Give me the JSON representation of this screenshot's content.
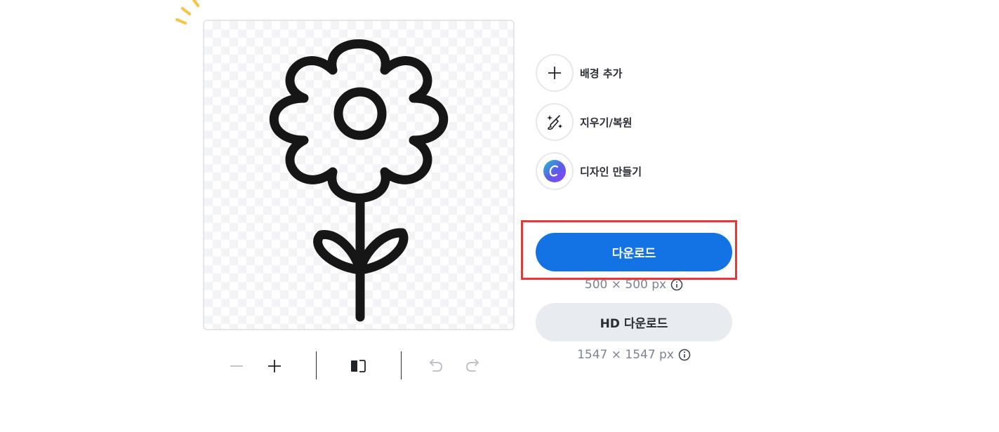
{
  "actions": [
    {
      "label": "배경 추가",
      "icon": "plus-icon"
    },
    {
      "label": "지우기/복원",
      "icon": "magic-brush-icon"
    },
    {
      "label": "디자인 만들기",
      "icon": "canva-logo-icon"
    }
  ],
  "download": {
    "button_label": "다운로드",
    "size_label": "500 × 500 px"
  },
  "hd_download": {
    "button_label": "HD 다운로드",
    "size_label": "1547 × 1547 px"
  },
  "toolbar": {
    "icons": [
      "zoom-out-icon",
      "zoom-in-icon",
      "flip-icon",
      "undo-icon",
      "redo-icon"
    ]
  },
  "colors": {
    "primary": "#1373e5",
    "secondary_bg": "#e8ebef",
    "highlight": "#e53935",
    "sparkle": "#f6c342"
  }
}
